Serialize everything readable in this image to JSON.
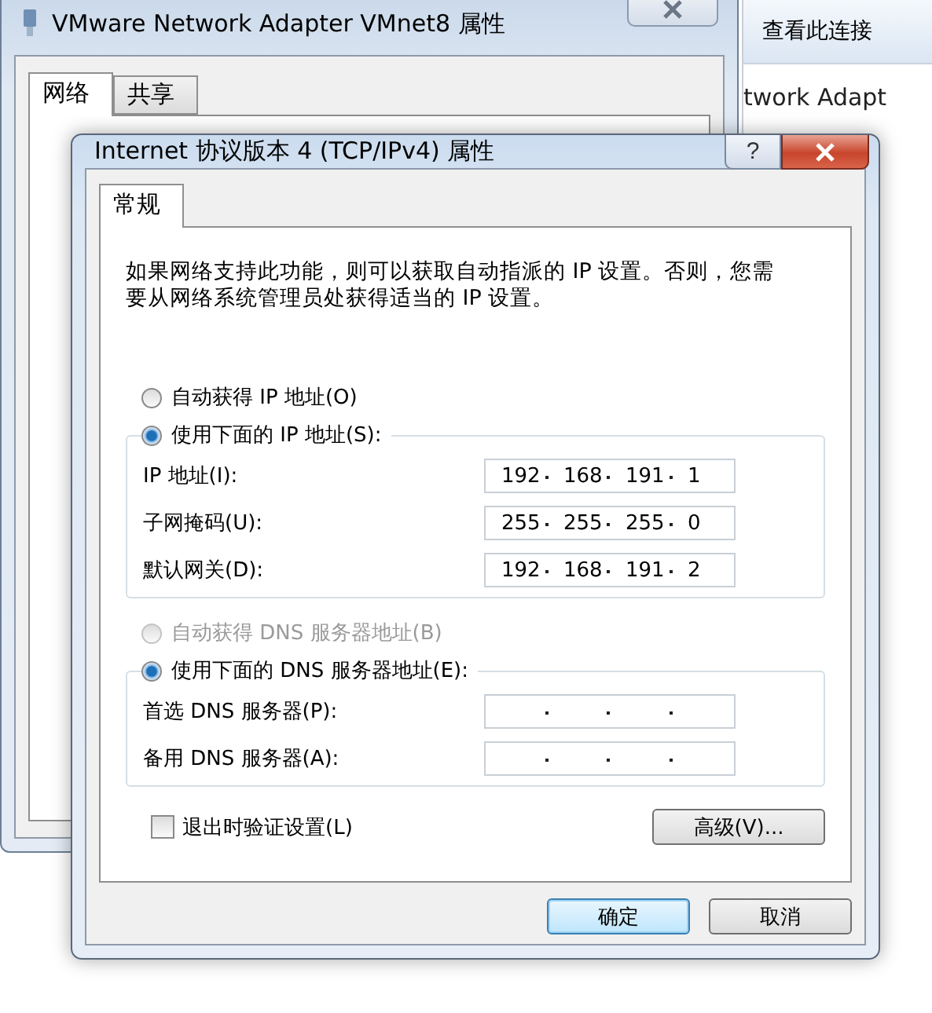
{
  "back_window": {
    "title": "VMware Network Adapter VMnet8 属性",
    "tabs": [
      {
        "label": "网络",
        "selected": true
      },
      {
        "label": "共享",
        "selected": false
      }
    ]
  },
  "side_window": {
    "header": "查看此连接",
    "item": "twork Adapt"
  },
  "dialog": {
    "title": "Internet 协议版本 4 (TCP/IPv4) 属性",
    "help_button": "?",
    "tabs": [
      {
        "label": "常规",
        "selected": true
      }
    ],
    "description": "如果网络支持此功能，则可以获取自动指派的 IP 设置。否则，您需要从网络系统管理员处获得适当的 IP 设置。",
    "ip_options": [
      {
        "label": "自动获得 IP 地址(O)",
        "selected": false,
        "disabled": false
      },
      {
        "label": "使用下面的 IP 地址(S):",
        "selected": true,
        "disabled": false
      }
    ],
    "ip_fields": [
      {
        "label": "IP 地址(I):",
        "octets": [
          "192",
          "168",
          "191",
          "1"
        ]
      },
      {
        "label": "子网掩码(U):",
        "octets": [
          "255",
          "255",
          "255",
          "0"
        ]
      },
      {
        "label": "默认网关(D):",
        "octets": [
          "192",
          "168",
          "191",
          "2"
        ]
      }
    ],
    "dns_options": [
      {
        "label": "自动获得 DNS 服务器地址(B)",
        "selected": false,
        "disabled": true
      },
      {
        "label": "使用下面的 DNS 服务器地址(E):",
        "selected": true,
        "disabled": false
      }
    ],
    "dns_fields": [
      {
        "label": "首选 DNS 服务器(P):"
      },
      {
        "label": "备用 DNS 服务器(A):"
      }
    ],
    "validate_checkbox": {
      "label": "退出时验证设置(L)",
      "checked": false
    },
    "advanced_button": "高级(V)...",
    "buttons": [
      {
        "label": "确定",
        "default": true
      },
      {
        "label": "取消",
        "default": false
      }
    ]
  }
}
